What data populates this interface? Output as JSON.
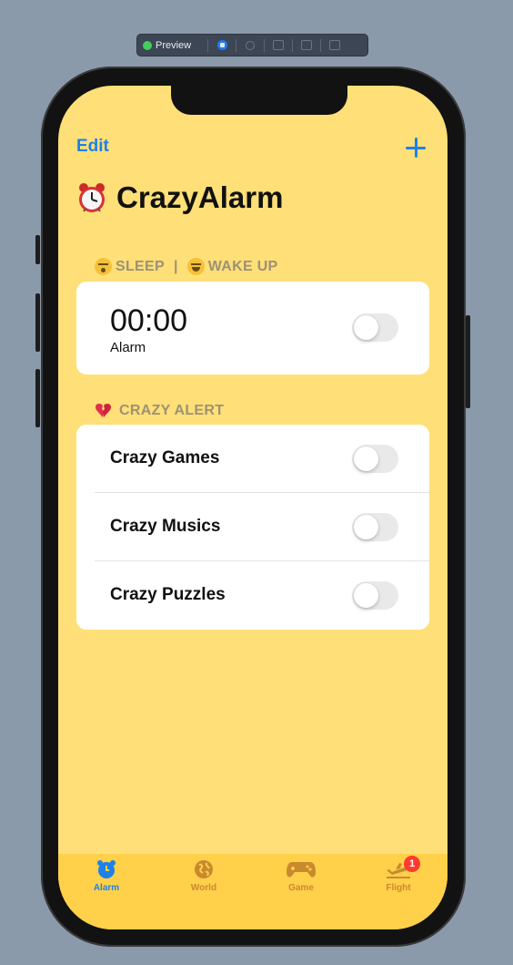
{
  "preview_toolbar": {
    "label": "Preview"
  },
  "nav": {
    "edit_label": "Edit"
  },
  "title": "CrazyAlarm",
  "sleep_section": {
    "header_sleep": "SLEEP",
    "header_sep": "|",
    "header_wake": "WAKE UP",
    "time": "00:00",
    "subtitle": "Alarm",
    "toggle_on": false
  },
  "crazy_section": {
    "header": "CRAZY ALERT",
    "rows": [
      {
        "label": "Crazy Games",
        "on": false
      },
      {
        "label": "Crazy Musics",
        "on": false
      },
      {
        "label": "Crazy Puzzles",
        "on": false
      }
    ]
  },
  "tabbar": {
    "tabs": [
      {
        "label": "Alarm",
        "icon": "alarm-clock-icon",
        "active": true
      },
      {
        "label": "World",
        "icon": "globe-icon",
        "active": false
      },
      {
        "label": "Game",
        "icon": "gamecontroller-icon",
        "active": false
      },
      {
        "label": "Flight",
        "icon": "airplane-departure-icon",
        "active": false,
        "badge": "1"
      }
    ]
  },
  "colors": {
    "background": "#ffdf77",
    "tabbar": "#ffd04a",
    "accent": "#1e80ea",
    "inactive_tab": "#c98a2e",
    "badge": "#ff3b30"
  }
}
